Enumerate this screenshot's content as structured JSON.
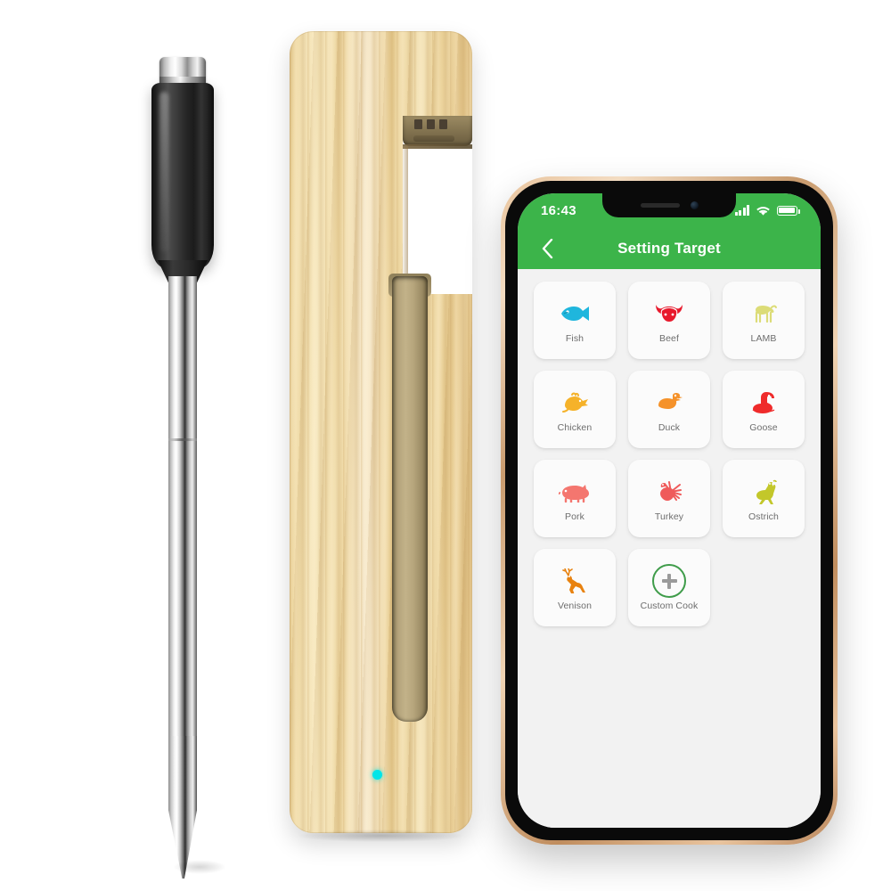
{
  "scene": {
    "products": [
      {
        "name": "wireless-meat-thermometer-probe",
        "parts": [
          "chrome-cap",
          "black-handle",
          "stainless-shaft",
          "pointed-tip"
        ]
      },
      {
        "name": "wooden-charging-case",
        "parts": [
          "pine-wood-body",
          "charging-notch",
          "contact-pins",
          "probe-slot",
          "led-indicator"
        ]
      },
      {
        "name": "smartphone",
        "parts": [
          "gold-frame",
          "black-bezel",
          "app-screen"
        ]
      }
    ]
  },
  "phone": {
    "status_bar": {
      "time": "16:43",
      "signal_icon": "cellular-bars-icon",
      "wifi_icon": "wifi-icon",
      "battery_icon": "battery-full-icon"
    },
    "nav": {
      "back_icon": "chevron-left-icon",
      "title": "Setting Target"
    },
    "colors": {
      "brand_green": "#3cb44a",
      "screen_bg": "#f2f2f2",
      "tile_bg": "#fbfbfb",
      "label_gray": "#6d6d6d",
      "led_cyan": "#00e5e8"
    },
    "grid": {
      "tiles": [
        {
          "label": "Fish",
          "icon": "fish-icon",
          "color": "#1fb6dd"
        },
        {
          "label": "Beef",
          "icon": "bull-icon",
          "color": "#e8192c"
        },
        {
          "label": "LAMB",
          "icon": "lamb-icon",
          "color": "#dcdc77"
        },
        {
          "label": "Chicken",
          "icon": "chicken-icon",
          "color": "#f5b battle"
        },
        {
          "label": "Duck",
          "icon": "duck-icon",
          "color": "#f5922a"
        },
        {
          "label": "Goose",
          "icon": "goose-icon",
          "color": "#ef2b2b"
        },
        {
          "label": "Pork",
          "icon": "pig-icon",
          "color": "#f4766f"
        },
        {
          "label": "Turkey",
          "icon": "turkey-icon",
          "color": "#ef5b5b"
        },
        {
          "label": "Ostrich",
          "icon": "ostrich-icon",
          "color": "#c3c72a"
        },
        {
          "label": "Venison",
          "icon": "deer-icon",
          "color": "#e8820f"
        },
        {
          "label": "Custom Cook",
          "icon": "plus-circle-icon",
          "color": "#3f9c4a"
        }
      ]
    }
  }
}
